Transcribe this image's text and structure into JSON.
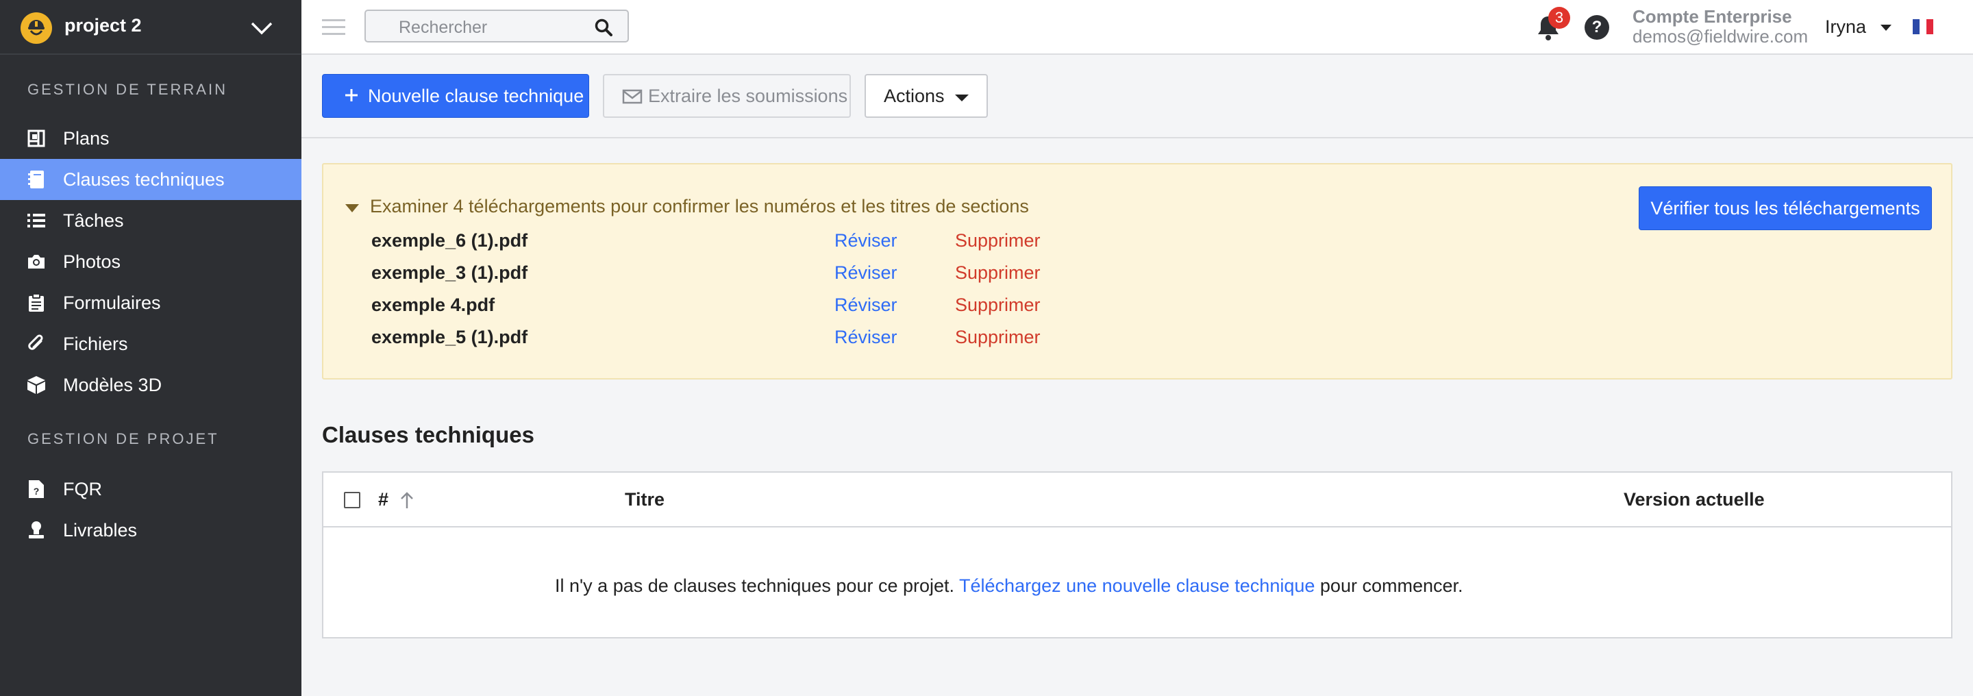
{
  "project": {
    "name": "project 2"
  },
  "sidebar": {
    "sections": [
      {
        "title": "GESTION DE TERRAIN"
      },
      {
        "title": "GESTION DE PROJET"
      }
    ],
    "items": [
      {
        "label": "Plans",
        "icon": "plans-icon"
      },
      {
        "label": "Clauses techniques",
        "icon": "specifications-icon",
        "active": true
      },
      {
        "label": "Tâches",
        "icon": "tasks-list-icon"
      },
      {
        "label": "Photos",
        "icon": "camera-icon"
      },
      {
        "label": "Formulaires",
        "icon": "clipboard-icon"
      },
      {
        "label": "Fichiers",
        "icon": "paperclip-icon"
      },
      {
        "label": "Modèles 3D",
        "icon": "cube-icon"
      },
      {
        "label": "FQR",
        "icon": "rfi-file-icon"
      },
      {
        "label": "Livrables",
        "icon": "submittals-icon"
      }
    ]
  },
  "topbar": {
    "search": {
      "placeholder": "Rechercher"
    },
    "notifications": {
      "count": "3"
    },
    "help": "?",
    "account": {
      "name": "Compte Enterprise",
      "email": "demos@fieldwire.com"
    },
    "user": "Iryna",
    "language_flag": "fr-flag-icon"
  },
  "toolbar": {
    "new_spec_label": "Nouvelle clause technique",
    "extract_label": "Extraire les soumissions",
    "actions_label": "Actions"
  },
  "alert": {
    "title": "Examiner 4 téléchargements pour confirmer les numéros et les titres de sections",
    "verify_all_label": "Vérifier tous les téléchargements",
    "uploads": [
      {
        "name": "exemple_6 (1).pdf",
        "review": "Réviser",
        "delete": "Supprimer"
      },
      {
        "name": "exemple_3 (1).pdf",
        "review": "Réviser",
        "delete": "Supprimer"
      },
      {
        "name": "exemple 4.pdf",
        "review": "Réviser",
        "delete": "Supprimer"
      },
      {
        "name": "exemple_5 (1).pdf",
        "review": "Réviser",
        "delete": "Supprimer"
      }
    ]
  },
  "specs": {
    "heading": "Clauses techniques",
    "columns": {
      "number": "#",
      "title": "Titre",
      "version": "Version actuelle"
    },
    "empty": {
      "before": "Il n'y a pas de clauses techniques pour ce projet.",
      "link": "Téléchargez une nouvelle clause technique",
      "after": "pour commencer."
    }
  },
  "colors": {
    "sidebar_bg": "#2d2f33",
    "active_item": "#6c98f7",
    "primary": "#2f6cf6",
    "danger": "#d13b2b",
    "alert_bg": "#fdf5dc",
    "alert_text": "#7a6226"
  }
}
